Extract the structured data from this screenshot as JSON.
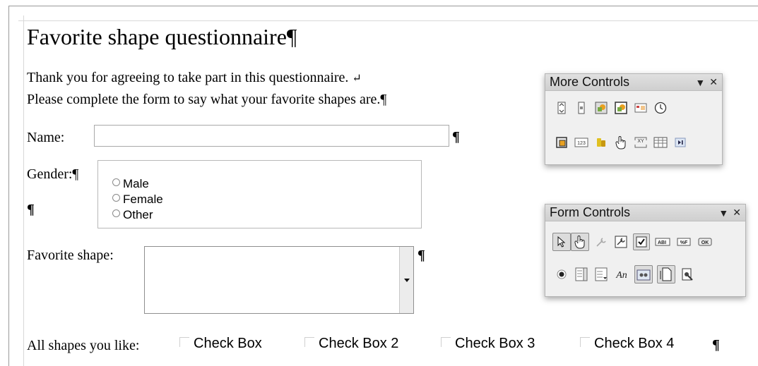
{
  "document": {
    "title": "Favorite shape questionnaire",
    "pilcrow": "¶",
    "line_break": "↵",
    "intro_line1": "Thank you for agreeing to take part in this questionnaire.",
    "intro_line2": "Please complete the form to say what your favorite shapes are.",
    "name_label": "Name:",
    "name_value": "",
    "gender_label": "Gender:",
    "gender_options": [
      "Male",
      "Female",
      "Other"
    ],
    "favorite_label": "Favorite shape:",
    "all_shapes_label": "All shapes you like:",
    "checkboxes": [
      "Check Box",
      "Check Box 2",
      "Check Box 3",
      "Check Box 4"
    ]
  },
  "more_controls": {
    "title": "More Controls",
    "menu_glyph": "▼",
    "close_glyph": "✕",
    "row1_icons": [
      "spin-button-icon",
      "scrollbar-icon",
      "image-button-icon",
      "image-control-icon",
      "date-field-icon",
      "time-field-icon"
    ],
    "row2_icons": [
      "navigation-bar-icon",
      "numeric-field-icon",
      "currency-field-icon",
      "pattern-field-icon",
      "formatted-field-icon",
      "table-control-icon",
      "navigation-end-icon"
    ],
    "numeric_text": "123",
    "xy_text": "XY"
  },
  "form_controls": {
    "title": "Form Controls",
    "menu_glyph": "▼",
    "close_glyph": "✕",
    "row1_icons": [
      "select-icon",
      "design-mode-icon",
      "control-properties-icon",
      "form-design-icon",
      "checkbox-icon",
      "text-box-icon",
      "formatted-field-icon",
      "push-button-icon"
    ],
    "row2_icons": [
      "option-button-icon",
      "list-box-icon",
      "combo-box-icon",
      "label-field-icon",
      "group-box-icon",
      "form-navigator-icon",
      "activate-wizards-icon"
    ],
    "textbox_text": "ABI",
    "formatted_text": "%F",
    "ok_text": "OK",
    "label_text": "An"
  }
}
